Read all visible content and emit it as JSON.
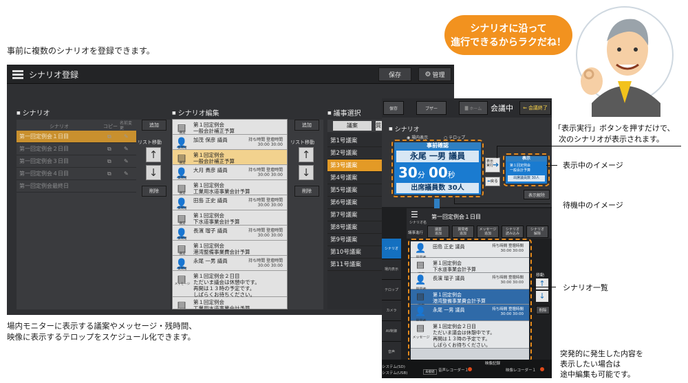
{
  "captions": {
    "top": "事前に複数のシナリオを登録できます。",
    "bottom_line1": "場内モニターに表示する議案やメッセージ・残時間、",
    "bottom_line2": "映像に表示するテロップをスケジュール化できます。",
    "callout_show_line1": "「表示実行」ボタンを押すだけで、",
    "callout_show_line2": "次のシナリオが表示されます。",
    "label_showing": "表示中のイメージ",
    "label_waiting": "待機中のイメージ",
    "label_list": "シナリオ一覧",
    "edit_note_line1": "突発的に発生した内容を",
    "edit_note_line2": "表示したい場合は",
    "edit_note_line3": "途中編集も可能です。"
  },
  "bubble": {
    "line1": "シナリオに沿って",
    "line2": "進行できるからラクだね！"
  },
  "app1": {
    "title": "シナリオ登録",
    "save": "保存",
    "settings": "管理",
    "scenario_section": "シナリオ",
    "scenario_col": "シナリオ",
    "scenario_col2": "コピー",
    "scenario_col3": "名前変更",
    "scenarios": [
      "第一回定例会１日目",
      "第一回定例会２日目",
      "第一回定例会３日目",
      "第一回定例会４日目",
      "第一回定例会最終日"
    ],
    "add": "追加",
    "list_move": "リスト移動",
    "delete": "削除",
    "edit_section": "シナリオ編集",
    "edit_rows": [
      {
        "icon": "doc",
        "label": "議案",
        "text": "第１回定例会\n一般会計補正予算",
        "time": ""
      },
      {
        "icon": "person",
        "label": "質問者",
        "text": "加茂 保彦 議員",
        "time": "持ち時間 登壇時間\n30:00  30:00"
      },
      {
        "icon": "doc",
        "label": "議案",
        "text": "第１回定例会\n一般会計補正予算",
        "time": ""
      },
      {
        "icon": "person",
        "label": "質問者",
        "text": "大月 貴彦 議員",
        "time": "持ち時間 登壇時間\n30:00  30:00"
      },
      {
        "icon": "doc",
        "label": "議案",
        "text": "第１回定例会\n工業用水道事業会計予算",
        "time": ""
      },
      {
        "icon": "person",
        "label": "質問者",
        "text": "田島 正史 議員",
        "time": "持ち時間 登壇時間\n30:00  30:00"
      },
      {
        "icon": "doc",
        "label": "議案",
        "text": "第１回定例会\n下水道事業会計予算",
        "time": ""
      },
      {
        "icon": "person",
        "label": "質問者",
        "text": "長濱 瑠子 議員",
        "time": "持ち時間 登壇時間\n30:00  30:00"
      },
      {
        "icon": "doc",
        "label": "議案",
        "text": "第１回定例会\n港湾整備事業費会計予算",
        "time": ""
      },
      {
        "icon": "person",
        "label": "質問者",
        "text": "永尾 一男 議員",
        "time": "持ち時間 登壇時間\n30:00  30:00"
      },
      {
        "icon": "doc",
        "label": "メッセージ",
        "text": "第１回定例会２日目\nただいま議会は休憩中です。\n再開は１３時の予定です。\nしばらくお待ちください。",
        "time": ""
      },
      {
        "icon": "doc",
        "label": "議案",
        "text": "第１回定例会\n工業用水道事業会計予算",
        "time": ""
      }
    ],
    "add2": "追加",
    "list_move2": "リスト移動",
    "delete2": "削除",
    "agenda_section": "議事選択",
    "agenda_tab1": "議案",
    "agenda_tab2": "質",
    "agendas": [
      "第1号議案",
      "第2号議案",
      "第3号議案",
      "第4号議案",
      "第5号議案",
      "第6号議案",
      "第7号議案",
      "第8号議案",
      "第9号議案",
      "第10号議案",
      "第11号議案"
    ],
    "agenda_selected": 2
  },
  "app2": {
    "btn1": "保存",
    "btn2": "ブザー",
    "btn3": "ホーム",
    "status": "会議中",
    "end": "会議終了",
    "scenario_section": "シナリオ",
    "radio1": "場内表示",
    "radio2": "テロップ",
    "monitor_title": "事前確認",
    "monitor_name": "永尾 一男 議員",
    "monitor_min": "30",
    "monitor_min_unit": "分",
    "monitor_sec": "00",
    "monitor_sec_unit": "秒",
    "monitor_attend": "出席議員数 30人",
    "show_btn": "表示実行",
    "back_btn": "戻る",
    "current_title": "表示",
    "current_line1": "第１回定例会",
    "current_line2": "一般会計予算",
    "current_line3": "出席議員数 30人",
    "release_btn": "表示解除",
    "scenario_name_label": "シナリオ名",
    "scenario_name": "第一回定例会１日目",
    "toolbar": [
      "議案\n追加",
      "質問者\n追加",
      "メッセージ\n追加",
      "シナリオ\n読み込み",
      "シナリオ\n解除"
    ],
    "toolbar_label": "議事進行",
    "rows": [
      {
        "icon": "person",
        "label": "質問者",
        "text": "田島 正史 議員",
        "time": "持ち時間 登壇時間\n30:00  30:00",
        "hl": false
      },
      {
        "icon": "doc",
        "label": "議案",
        "text": "第１回定例会\n下水道事業会計予算",
        "time": "",
        "hl": false
      },
      {
        "icon": "person",
        "label": "質問者",
        "text": "長濱 瑠子 議員",
        "time": "持ち時間 登壇時間\n30:00  30:00",
        "hl": false
      },
      {
        "icon": "doc",
        "label": "議案",
        "text": "第１回定例会\n港湾整備事業費会計予算",
        "time": "",
        "hl": true
      },
      {
        "icon": "person",
        "label": "質問者",
        "text": "永尾 一男 議員",
        "time": "持ち時間 登壇時間\n30:00  30:00",
        "hl": true
      },
      {
        "icon": "doc",
        "label": "メッセージ",
        "text": "第１回定例会２日目\nただいま議会は休憩中です。\n再開は１３時の予定です。\nしばらくお待ちください。",
        "time": "",
        "hl": false
      }
    ],
    "tabs": [
      "シナリオ",
      "場内表示",
      "テロップ",
      "カメラ",
      "AV制御",
      "音声"
    ],
    "move": "移動",
    "del": "削除",
    "footer_sys1": "システム(SD)",
    "footer_sys2": "システム(USB)",
    "footer_unplugged": "未接続",
    "footer_rec_title": "映像記録",
    "footer_rec1": "音声レコーダー１",
    "footer_rec2": "映像レコーダー１"
  }
}
